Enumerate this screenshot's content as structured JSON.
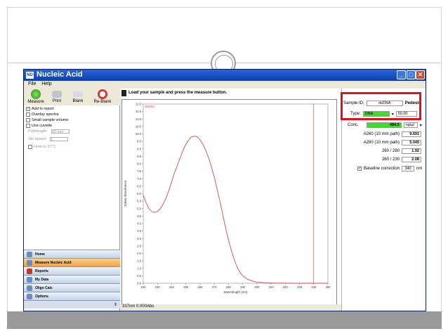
{
  "window": {
    "title": "Nucleic Acid"
  },
  "menu": [
    "File",
    "Help"
  ],
  "toolbar": [
    "Measure",
    "Print",
    "Blank",
    "Re-Blank"
  ],
  "options": {
    "add_to_report": "Add to report",
    "overlay_spectra": "Overlay spectra",
    "small_sample_volume": "Small sample volume",
    "use_cuvette": "Use cuvette",
    "pathlength_label": "Pathlength:",
    "pathlength_value": "10 mm",
    "stir_speed_label": "Stir speed:",
    "stir_speed_value": "1",
    "heat_label": "Heat to 37°C"
  },
  "nav": [
    "Home",
    "Measure Nucleic Acid",
    "Reports",
    "My Data",
    "Oligo Calc",
    "Options"
  ],
  "message": "Load your sample and press the measure button.",
  "chart_data": {
    "type": "line",
    "series": [
      {
        "name": "dsDNA",
        "x": [
          220,
          222,
          224,
          226,
          228,
          230,
          232,
          234,
          236,
          238,
          240,
          242,
          244,
          246,
          248,
          250,
          252,
          254,
          256,
          258,
          260,
          262,
          264,
          266,
          268,
          270,
          272,
          274,
          276,
          278,
          280,
          282,
          284,
          286,
          288,
          290,
          292,
          294,
          296,
          298,
          300,
          305,
          310,
          315,
          320,
          325,
          330,
          335,
          340,
          345,
          350
        ],
        "y": [
          5.9,
          5.4,
          5.0,
          4.8,
          4.75,
          4.8,
          5.0,
          5.3,
          5.7,
          6.2,
          6.8,
          7.4,
          7.9,
          8.4,
          8.9,
          9.3,
          9.6,
          9.8,
          9.85,
          9.8,
          9.6,
          9.3,
          8.9,
          8.4,
          7.8,
          7.1,
          6.3,
          5.5,
          4.6,
          3.7,
          2.9,
          2.2,
          1.6,
          1.1,
          0.75,
          0.5,
          0.35,
          0.25,
          0.18,
          0.12,
          0.08,
          0.04,
          0.02,
          0.01,
          0.01,
          0.0,
          0.0,
          0.0,
          0.0,
          0.0,
          0.0
        ]
      }
    ],
    "xlabel": "Wavelength (nm)",
    "ylabel": "10mm Absorbance",
    "xlim": [
      220,
      350
    ],
    "ylim": [
      0,
      12
    ],
    "xticks": [
      220,
      230,
      240,
      250,
      260,
      270,
      280,
      290,
      300,
      310,
      320,
      330,
      340,
      350
    ],
    "yticks": [
      0.0,
      0.5,
      1.0,
      1.5,
      2.0,
      2.5,
      3.0,
      3.5,
      4.0,
      4.5,
      5.0,
      5.5,
      6.0,
      6.5,
      7.0,
      7.5,
      8.0,
      8.5,
      9.0,
      9.5,
      10.0,
      10.5,
      11.0,
      11.5,
      12.0
    ],
    "marker_x": 340,
    "series_color": "#d04a4a",
    "grid": false
  },
  "status": "337nm 0.000Abs",
  "right": {
    "sample_id_label": "Sample ID:",
    "sample_id_value": "dsDNA",
    "pedestal": "Pedesta",
    "type_label": "Type:",
    "type_value": "DNA",
    "type_factor": "50.00",
    "conc_label": "Conc.",
    "conc_value": "484.5",
    "conc_unit": "ng/µl",
    "a260_label": "A260 (10 mm path)",
    "a260_value": "9.691",
    "a280_label": "A280 (10 mm path)",
    "a280_value": "5.045",
    "r260_280_label": "260 / 280",
    "r260_280_value": "1.92",
    "r260_230_label": "260 / 230",
    "r260_230_value": "2.08",
    "baseline_label": "Baseline correction",
    "baseline_value": "340",
    "baseline_unit": "nm"
  },
  "colors": {
    "highlight": "#e0121d",
    "title_bar": "#0b3fb1",
    "conc_bg": "#3fdc2a"
  }
}
